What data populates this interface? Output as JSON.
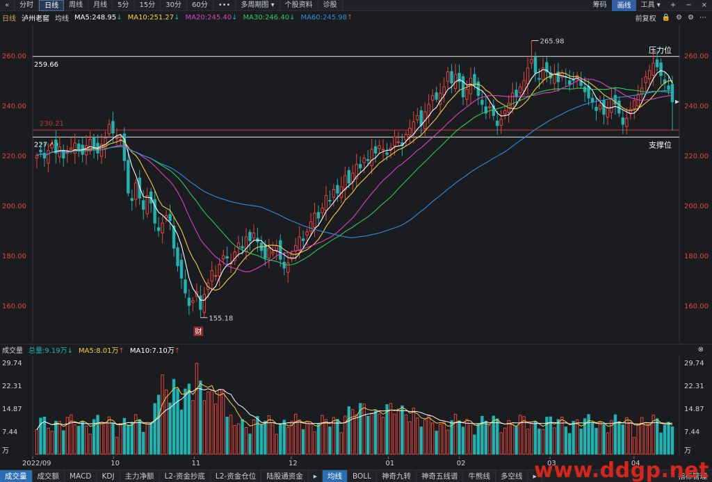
{
  "toolbar": {
    "back_icon": "double-chevron-left-icon",
    "back_glyph": "«",
    "tabs": [
      "分时",
      "日线",
      "周线",
      "月线",
      "5分",
      "15分",
      "30分",
      "60分",
      "•••",
      "多周期图 ▾",
      "个股资料",
      "诊股"
    ],
    "right": [
      "筹码",
      "画线",
      "工具 ▾"
    ],
    "win_icons": [
      "+",
      "−",
      "×"
    ]
  },
  "info": {
    "period": "日线",
    "stock": "泸州老窖",
    "ma_label": "均线",
    "ma5": "MA5:248.95",
    "ma5_arrow": "↓",
    "ma10": "MA10:251.27",
    "ma10_arrow": "↓",
    "ma20": "MA20:245.40",
    "ma20_arrow": "↓",
    "ma30": "MA30:246.40",
    "ma30_arrow": "↓",
    "ma60": "MA60:245.98",
    "ma60_arrow": "↑",
    "fq": "前复权",
    "icons": [
      "lock-icon",
      "gear-icon",
      "settings-icon",
      "dots-icon"
    ]
  },
  "price_axis": {
    "ticks": [
      "260.00",
      "240.00",
      "220.00",
      "200.00",
      "180.00",
      "160.00"
    ],
    "tick_values": [
      260,
      240,
      220,
      200,
      180,
      160
    ]
  },
  "annotations": {
    "high": "265.98",
    "low": "155.18",
    "line_259": "259.66",
    "line_230": "230.21",
    "line_227": "227.40",
    "pressure": "压力位",
    "support": "支撑位",
    "cai": "财"
  },
  "volume": {
    "title": "成交量",
    "total": "总量:9.19万",
    "total_arrow": "↓",
    "ma5": "MA5:8.01万",
    "ma5_arrow": "↑",
    "ma10": "MA10:7.10万",
    "ma10_arrow": "↑",
    "axis_ticks": [
      "29.74",
      "22.31",
      "14.87",
      "7.44",
      "万"
    ],
    "axis_values": [
      29.74,
      22.31,
      14.87,
      7.44,
      0
    ]
  },
  "dates": [
    "2022/09",
    "10",
    "11",
    "12",
    "01",
    "02",
    "03",
    "04"
  ],
  "bottom_tabs": [
    "成交量",
    "成交额",
    "MACD",
    "KDJ",
    "主力净额",
    "L2-资金抄底",
    "L2-资金仓位",
    "陆股通资金",
    "▸",
    "均线",
    "BOLL",
    "神奇九转",
    "神奇五线谱",
    "牛熊线",
    "多空线",
    "▸"
  ],
  "bottom_right": "指标管理",
  "watermark": "www.ddgp.net",
  "colors": {
    "up": "#e8453c",
    "down": "#1fb3b3",
    "ma5": "#ffffff",
    "ma10": "#f5d03a",
    "ma20": "#e040c8",
    "ma30": "#2ecc5c",
    "ma60": "#2f8fe0",
    "accent": "#2f6fb3"
  },
  "chart_data": {
    "type": "candlestick",
    "x": [
      "2022/09",
      "10",
      "11",
      "12",
      "01",
      "02",
      "03",
      "04"
    ],
    "ylim": [
      150,
      268
    ],
    "close": [
      220.0,
      221.5,
      219.0,
      222.0,
      224.5,
      221.0,
      223.5,
      219.0,
      221.5,
      223.0,
      225.0,
      222.0,
      220.5,
      224.0,
      226.5,
      223.0,
      221.0,
      224.5,
      227.0,
      232.5,
      229.0,
      227.0,
      226.5,
      218.0,
      205.0,
      202.0,
      209.0,
      203.0,
      198.5,
      204.0,
      201.0,
      193.0,
      190.0,
      193.0,
      196.0,
      194.0,
      183.0,
      176.0,
      171.0,
      165.0,
      160.0,
      162.0,
      165.5,
      158.5,
      164.5,
      169.0,
      174.0,
      172.0,
      176.5,
      180.0,
      179.0,
      177.0,
      181.5,
      185.0,
      183.0,
      187.5,
      186.0,
      189.0,
      185.5,
      182.0,
      179.0,
      183.0,
      181.5,
      184.0,
      178.5,
      175.0,
      177.0,
      180.5,
      184.0,
      187.5,
      186.0,
      189.5,
      193.5,
      197.0,
      195.0,
      199.0,
      204.0,
      202.0,
      206.5,
      205.0,
      207.5,
      212.0,
      209.0,
      213.0,
      216.5,
      215.0,
      219.0,
      218.0,
      222.5,
      221.0,
      224.0,
      222.5,
      220.5,
      223.0,
      227.5,
      225.5,
      224.0,
      228.5,
      231.0,
      233.5,
      236.0,
      232.0,
      237.5,
      240.5,
      244.0,
      242.5,
      245.0,
      247.5,
      253.5,
      249.0,
      252.5,
      249.5,
      243.5,
      246.5,
      251.0,
      248.0,
      244.0,
      240.5,
      237.0,
      239.5,
      236.0,
      232.0,
      234.5,
      238.0,
      241.0,
      245.0,
      243.5,
      247.5,
      250.0,
      255.0,
      258.5,
      253.0,
      250.5,
      255.0,
      253.5,
      251.0,
      252.5,
      249.5,
      253.0,
      251.5,
      248.5,
      250.0,
      252.0,
      248.0,
      245.5,
      243.0,
      241.5,
      238.0,
      240.0,
      236.5,
      239.0,
      242.5,
      240.5,
      237.0,
      232.5,
      235.0,
      238.5,
      242.0,
      244.5,
      247.0,
      251.5,
      254.0,
      257.0,
      255.5,
      252.0,
      249.0,
      246.5,
      241.5
    ],
    "volume_ma5": 8.01,
    "volume_ma10": 7.1,
    "annotations": {
      "high": 265.98,
      "low": 155.18,
      "resistance": 259.66,
      "line_230": 230.21,
      "support": 227.4
    }
  }
}
